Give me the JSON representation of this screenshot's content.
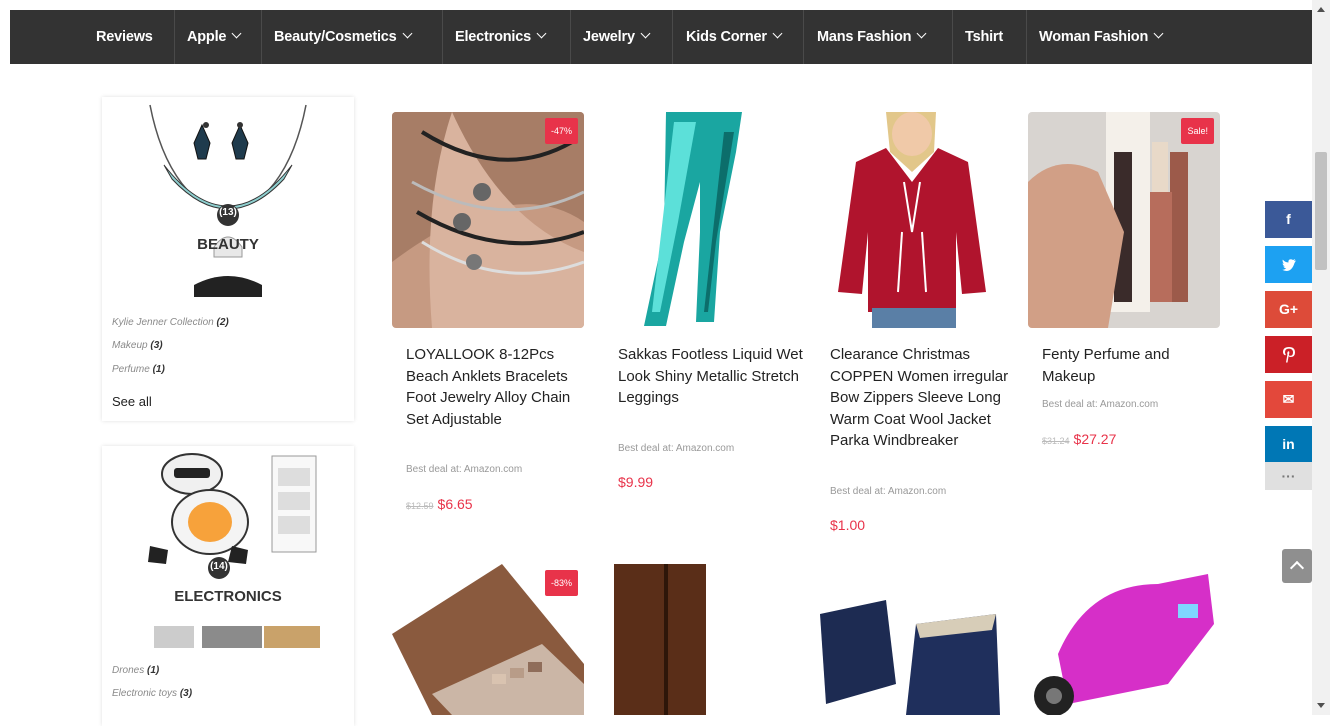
{
  "nav": {
    "items": [
      {
        "label": "Reviews"
      },
      {
        "label": "Apple"
      },
      {
        "label": "Beauty/Cosmetics"
      },
      {
        "label": "Electronics"
      },
      {
        "label": "Jewelry"
      },
      {
        "label": "Kids Corner"
      },
      {
        "label": "Mans Fashion"
      },
      {
        "label": "Tshirt"
      },
      {
        "label": "Woman Fashion"
      }
    ]
  },
  "categories": [
    {
      "title": "BEAUTY",
      "count": "(13)",
      "subs": [
        {
          "name": "Kylie Jenner Collection",
          "count": "(2)"
        },
        {
          "name": "Makeup",
          "count": "(3)"
        },
        {
          "name": "Perfume",
          "count": "(1)"
        }
      ],
      "see_all": "See all"
    },
    {
      "title": "ELECTRONICS",
      "count": "(14)",
      "subs": [
        {
          "name": "Drones",
          "count": "(1)"
        },
        {
          "name": "Electronic toys",
          "count": "(3)"
        }
      ]
    }
  ],
  "products": [
    {
      "badge": "-47%",
      "title": "LOYALLOOK 8-12Pcs Beach Anklets Bracelets Foot Jewelry Alloy Chain Set Adjustable",
      "deal": "Best deal at: Amazon.com",
      "old_price": "$12.59",
      "price": "$6.65"
    },
    {
      "badge": "",
      "title": "Sakkas Footless Liquid Wet Look Shiny Metallic Stretch Leggings",
      "deal": "Best deal at: Amazon.com",
      "old_price": "",
      "price": "$9.99"
    },
    {
      "badge": "",
      "title": "Clearance Christmas COPPEN Women irregular Bow Zippers Sleeve Long Warm Coat Wool Jacket Parka Windbreaker",
      "deal": "Best deal at: Amazon.com",
      "old_price": "",
      "price": "$1.00"
    },
    {
      "badge": "Sale!",
      "title": "Fenty Perfume and Makeup",
      "deal": "Best deal at: Amazon.com",
      "old_price": "$31.24",
      "price": "$27.27"
    },
    {
      "badge": "-83%"
    }
  ],
  "social": [
    {
      "label": "f",
      "color": "#3b5998"
    },
    {
      "label": "t",
      "color": "#1da1f2"
    },
    {
      "label": "G+",
      "color": "#dd4b39"
    },
    {
      "label": "P",
      "color": "#cb2027"
    },
    {
      "label": "✉",
      "color": "#e3483b"
    },
    {
      "label": "in",
      "color": "#0077b5"
    },
    {
      "label": "···",
      "color": "#e0e0e0"
    }
  ]
}
